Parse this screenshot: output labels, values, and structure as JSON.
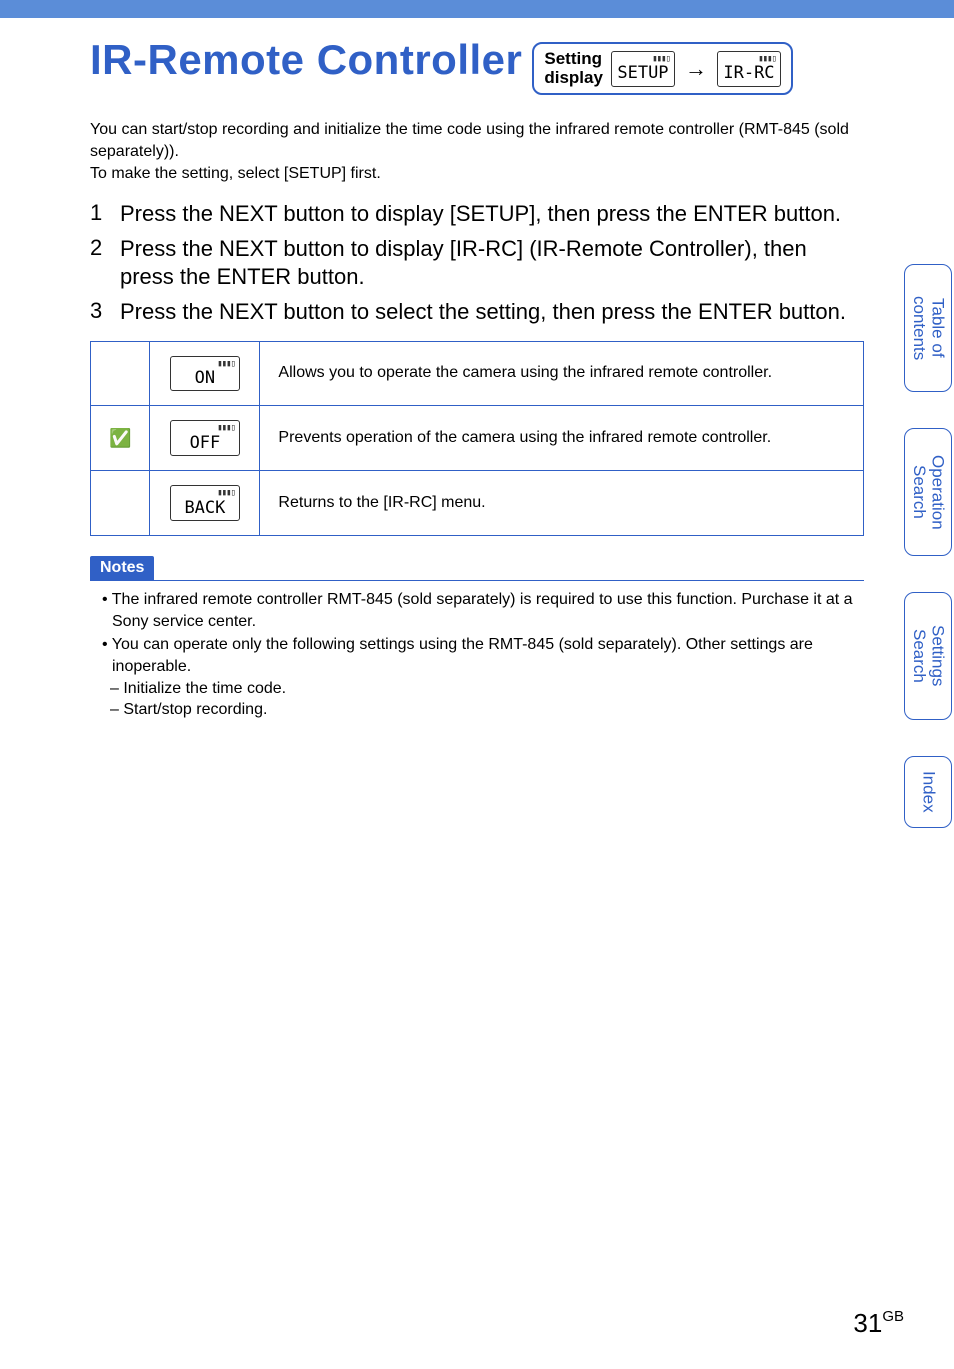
{
  "title": "IR-Remote Controller",
  "setting_display": {
    "label": "Setting\ndisplay",
    "lcd1": "SETUP",
    "lcd2": "IR-RC"
  },
  "intro": {
    "p1": "You can start/stop recording and initialize the time code using the infrared remote controller (RMT-845 (sold separately)).",
    "p2": "To make the setting, select [SETUP] first."
  },
  "steps": [
    "Press the NEXT button to display [SETUP], then press the ENTER button.",
    "Press the NEXT button to display [IR-RC] (IR-Remote Controller), then press the ENTER button.",
    "Press the NEXT button to select the setting, then press the ENTER button."
  ],
  "options": [
    {
      "default": false,
      "lcd": "ON",
      "desc": "Allows you to operate the camera using the infrared remote controller."
    },
    {
      "default": true,
      "lcd": "OFF",
      "desc": "Prevents operation of the camera using the infrared remote controller."
    },
    {
      "default": false,
      "lcd": "BACK",
      "desc": "Returns to the [IR-RC] menu."
    }
  ],
  "notes": {
    "heading": "Notes",
    "items": [
      "The infrared remote controller RMT-845 (sold separately) is required to use this function. Purchase it at a Sony service center.",
      "You can operate only the following settings using the RMT-845 (sold separately). Other settings are inoperable."
    ],
    "subitems": [
      "Initialize the time code.",
      "Start/stop recording."
    ]
  },
  "tabs": {
    "toc": "Table of\ncontents",
    "op": "Operation\nSearch",
    "set": "Settings\nSearch",
    "idx": "Index"
  },
  "page": {
    "num": "31",
    "suffix": "GB"
  }
}
